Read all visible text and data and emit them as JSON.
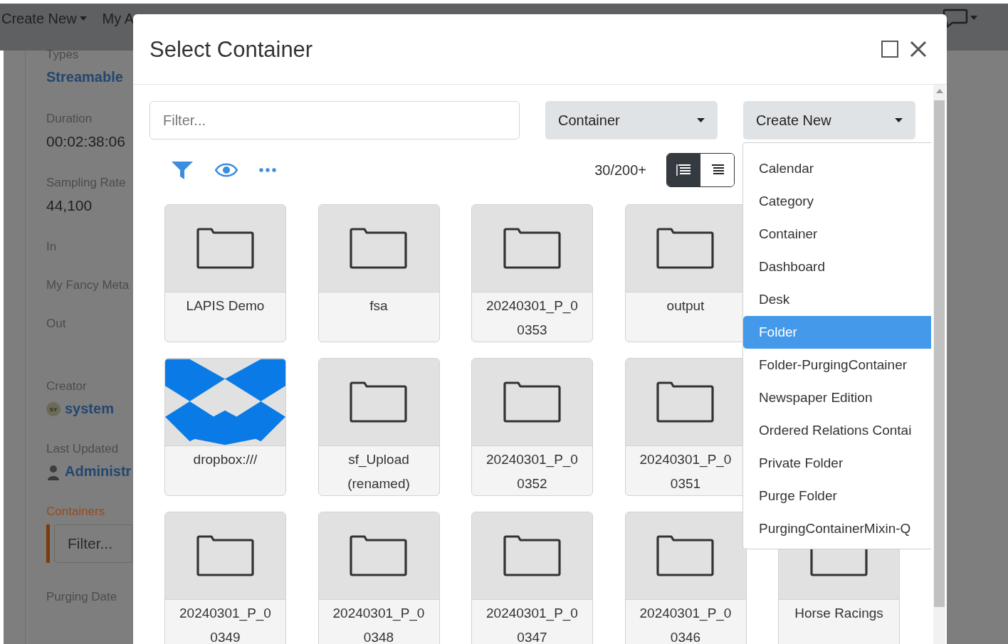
{
  "nav": {
    "items": [
      {
        "label": "Create New",
        "kind": "dropdown"
      },
      {
        "label": "My A",
        "kind": "link"
      }
    ]
  },
  "panel": {
    "fields": [
      {
        "label": "Types",
        "value": "Streamable",
        "kind": "link"
      },
      {
        "label": "Duration",
        "value": "00:02:38:06",
        "kind": "text"
      },
      {
        "label": "Sampling Rate",
        "value": "44,100",
        "kind": "text"
      },
      {
        "label": "In",
        "kind": "empty"
      },
      {
        "label": "My Fancy Meta",
        "kind": "empty"
      },
      {
        "label": "Out",
        "kind": "empty"
      },
      {
        "label": "Creator",
        "value": "system",
        "avatar": "SY",
        "kind": "user"
      },
      {
        "label": "Last Updated",
        "value": "Administr",
        "kind": "admin"
      },
      {
        "label": "Containers",
        "placeholder": "Filter...",
        "kind": "filter"
      },
      {
        "label": "Purging Date",
        "kind": "empty"
      }
    ]
  },
  "dialog": {
    "title": "Select Container",
    "filter": {
      "placeholder": "Filter..."
    },
    "type_select": "Container",
    "create_new": "Create New",
    "count": "30/200+",
    "view_toggle": [
      {
        "selected": true
      },
      {
        "selected": false
      }
    ],
    "tiles": [
      {
        "name": "LAPIS Demo",
        "kind": "folder"
      },
      {
        "name": "fsa",
        "kind": "folder"
      },
      {
        "name": "20240301_P_00353",
        "kind": "folder"
      },
      {
        "name": "output",
        "kind": "folder"
      },
      {
        "kind": "hidden"
      },
      {
        "name": "dropbox:///",
        "kind": "dropbox"
      },
      {
        "name": "sf_Upload (renamed)",
        "kind": "folder"
      },
      {
        "name": "20240301_P_00352",
        "kind": "folder"
      },
      {
        "name": "20240301_P_00351",
        "kind": "folder"
      },
      {
        "kind": "hidden"
      },
      {
        "name": "20240301_P_00349",
        "kind": "folder"
      },
      {
        "name": "20240301_P_00348",
        "kind": "folder"
      },
      {
        "name": "20240301_P_00347",
        "kind": "folder"
      },
      {
        "name": "20240301_P_00346",
        "kind": "folder"
      },
      {
        "name": "Horse Racings",
        "kind": "folder"
      }
    ],
    "menu": [
      {
        "label": "Calendar",
        "selected": false
      },
      {
        "label": "Category",
        "selected": false
      },
      {
        "label": "Container",
        "selected": false
      },
      {
        "label": "Dashboard",
        "selected": false
      },
      {
        "label": "Desk",
        "selected": false
      },
      {
        "label": "Folder",
        "selected": true
      },
      {
        "label": "Folder-PurgingContainer",
        "selected": false
      },
      {
        "label": "Newspaper Edition",
        "selected": false
      },
      {
        "label": "Ordered Relations Contai",
        "selected": false
      },
      {
        "label": "Private Folder",
        "selected": false
      },
      {
        "label": "Purge Folder",
        "selected": false
      },
      {
        "label": "PurgingContainerMixin-Q",
        "selected": false
      }
    ]
  }
}
